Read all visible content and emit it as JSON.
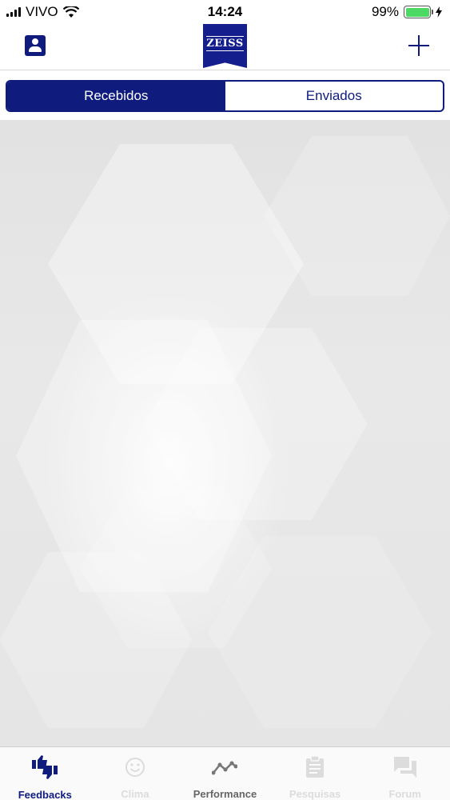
{
  "status_bar": {
    "carrier": "VIVO",
    "time": "14:24",
    "battery_percent": "99%",
    "battery_level": 0.99
  },
  "nav_bar": {
    "logo_text": "ZEISS",
    "left_icon": "profile-icon",
    "right_icon": "plus-icon"
  },
  "segmented": {
    "tabs": [
      {
        "label": "Recebidos",
        "active": true
      },
      {
        "label": "Enviados",
        "active": false
      }
    ]
  },
  "tab_bar": {
    "items": [
      {
        "label": "Feedbacks",
        "icon": "thumbs-icon",
        "state": "active"
      },
      {
        "label": "Clima",
        "icon": "smiley-icon",
        "state": "disabled"
      },
      {
        "label": "Performance",
        "icon": "trend-icon",
        "state": "enabled"
      },
      {
        "label": "Pesquisas",
        "icon": "clipboard-icon",
        "state": "disabled"
      },
      {
        "label": "Forum",
        "icon": "chat-icon",
        "state": "disabled"
      }
    ]
  },
  "colors": {
    "primary": "#0f1c7e",
    "logo": "#141e8c",
    "battery": "#4cd964"
  }
}
